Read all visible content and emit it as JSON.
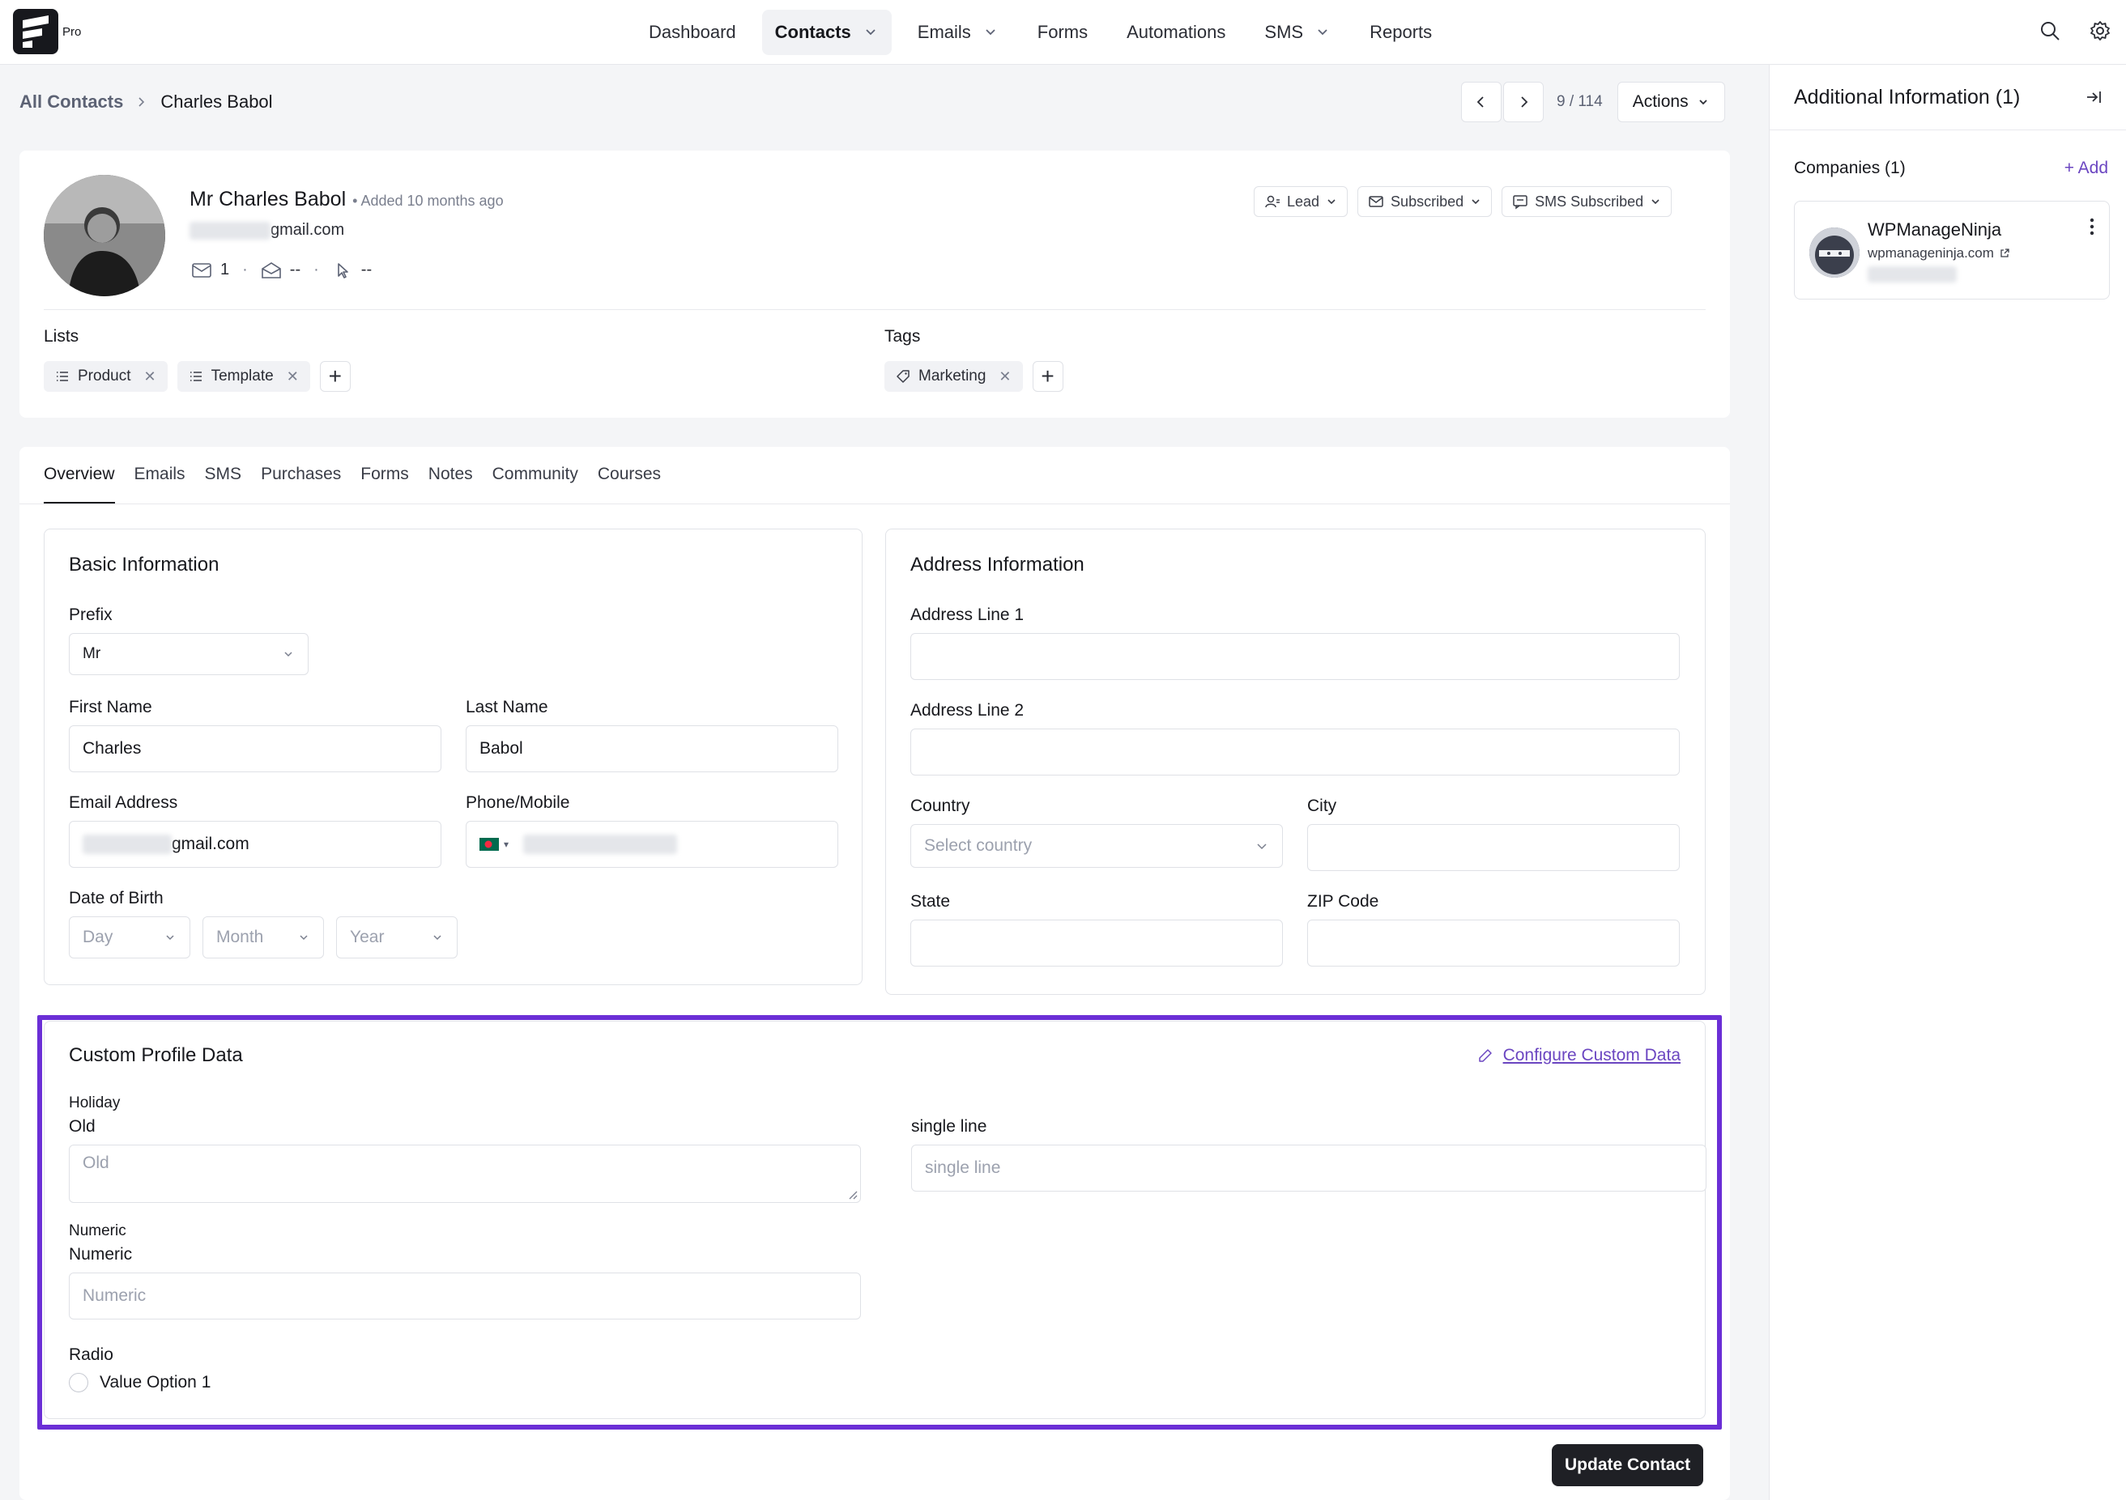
{
  "brand": {
    "pro_label": "Pro"
  },
  "nav": {
    "items": [
      {
        "label": "Dashboard",
        "has_dropdown": false,
        "active": false
      },
      {
        "label": "Contacts",
        "has_dropdown": true,
        "active": true
      },
      {
        "label": "Emails",
        "has_dropdown": true,
        "active": false
      },
      {
        "label": "Forms",
        "has_dropdown": false,
        "active": false
      },
      {
        "label": "Automations",
        "has_dropdown": false,
        "active": false
      },
      {
        "label": "SMS",
        "has_dropdown": true,
        "active": false
      },
      {
        "label": "Reports",
        "has_dropdown": false,
        "active": false
      }
    ]
  },
  "breadcrumb": {
    "root": "All Contacts",
    "current": "Charles Babol"
  },
  "pager": {
    "count": "9 / 114",
    "actions_label": "Actions"
  },
  "profile": {
    "name": "Mr Charles Babol",
    "added": "• Added 10 months ago",
    "email_suffix": "gmail.com",
    "emails_count": "1",
    "opens": "--",
    "clicks": "--",
    "status_lead": "Lead",
    "status_subscribed": "Subscribed",
    "status_sms": "SMS Subscribed",
    "lists_label": "Lists",
    "lists": [
      "Product",
      "Template"
    ],
    "tags_label": "Tags",
    "tags": [
      "Marketing"
    ]
  },
  "tabs": [
    "Overview",
    "Emails",
    "SMS",
    "Purchases",
    "Forms",
    "Notes",
    "Community",
    "Courses"
  ],
  "basic": {
    "title": "Basic Information",
    "prefix_label": "Prefix",
    "prefix_value": "Mr",
    "first_name_label": "First Name",
    "first_name_value": "Charles",
    "last_name_label": "Last Name",
    "last_name_value": "Babol",
    "email_label": "Email Address",
    "email_suffix": "gmail.com",
    "phone_label": "Phone/Mobile",
    "dob_label": "Date of Birth",
    "dob_day": "Day",
    "dob_month": "Month",
    "dob_year": "Year"
  },
  "address": {
    "title": "Address Information",
    "line1_label": "Address Line 1",
    "line2_label": "Address Line 2",
    "country_label": "Country",
    "country_placeholder": "Select country",
    "city_label": "City",
    "state_label": "State",
    "zip_label": "ZIP Code"
  },
  "custom": {
    "title": "Custom Profile Data",
    "configure_label": "Configure Custom Data",
    "group1_label": "Holiday",
    "old_label": "Old",
    "old_placeholder": "Old",
    "single_line_label": "single line",
    "single_line_placeholder": "single line",
    "group2_label": "Numeric",
    "numeric_label": "Numeric",
    "numeric_placeholder": "Numeric",
    "radio_label": "Radio",
    "radio_option": "Value Option 1"
  },
  "update_label": "Update Contact",
  "sidebar": {
    "title": "Additional Information (1)",
    "companies_label": "Companies (1)",
    "add_label": "+ Add",
    "company_name": "WPManageNinja",
    "company_url": "wpmanageninja.com"
  },
  "colors": {
    "accent": "#6b46c1",
    "highlight_border": "#6b2fd6",
    "dark": "#1f2025"
  }
}
